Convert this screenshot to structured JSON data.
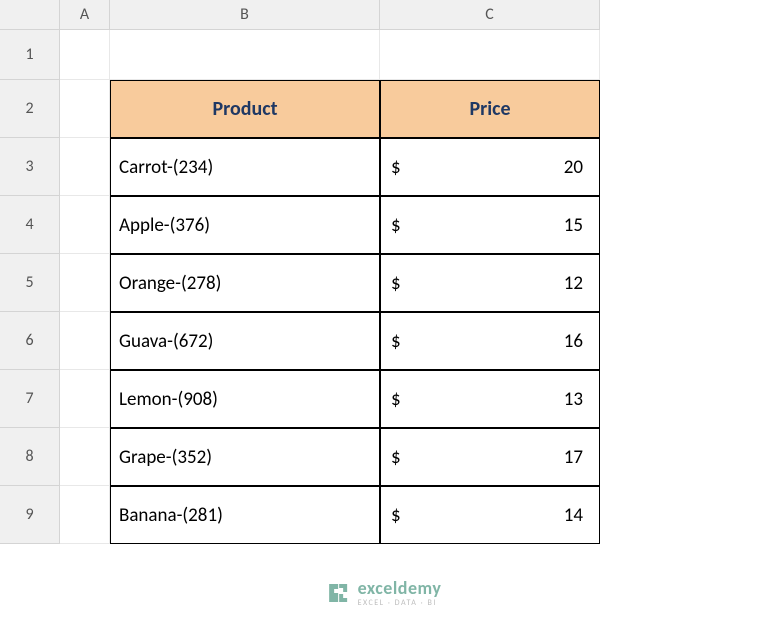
{
  "columns": [
    "A",
    "B",
    "C"
  ],
  "rows": [
    "1",
    "2",
    "3",
    "4",
    "5",
    "6",
    "7",
    "8",
    "9"
  ],
  "headers": {
    "product": "Product",
    "price": "Price"
  },
  "currency": "$",
  "data": [
    {
      "product": "Carrot-(234)",
      "price": "20"
    },
    {
      "product": "Apple-(376)",
      "price": "15"
    },
    {
      "product": "Orange-(278)",
      "price": "12"
    },
    {
      "product": "Guava-(672)",
      "price": "16"
    },
    {
      "product": "Lemon-(908)",
      "price": "13"
    },
    {
      "product": "Grape-(352)",
      "price": "17"
    },
    {
      "product": "Banana-(281)",
      "price": "14"
    }
  ],
  "watermark": {
    "title": "exceldemy",
    "subtitle": "EXCEL · DATA · BI"
  }
}
